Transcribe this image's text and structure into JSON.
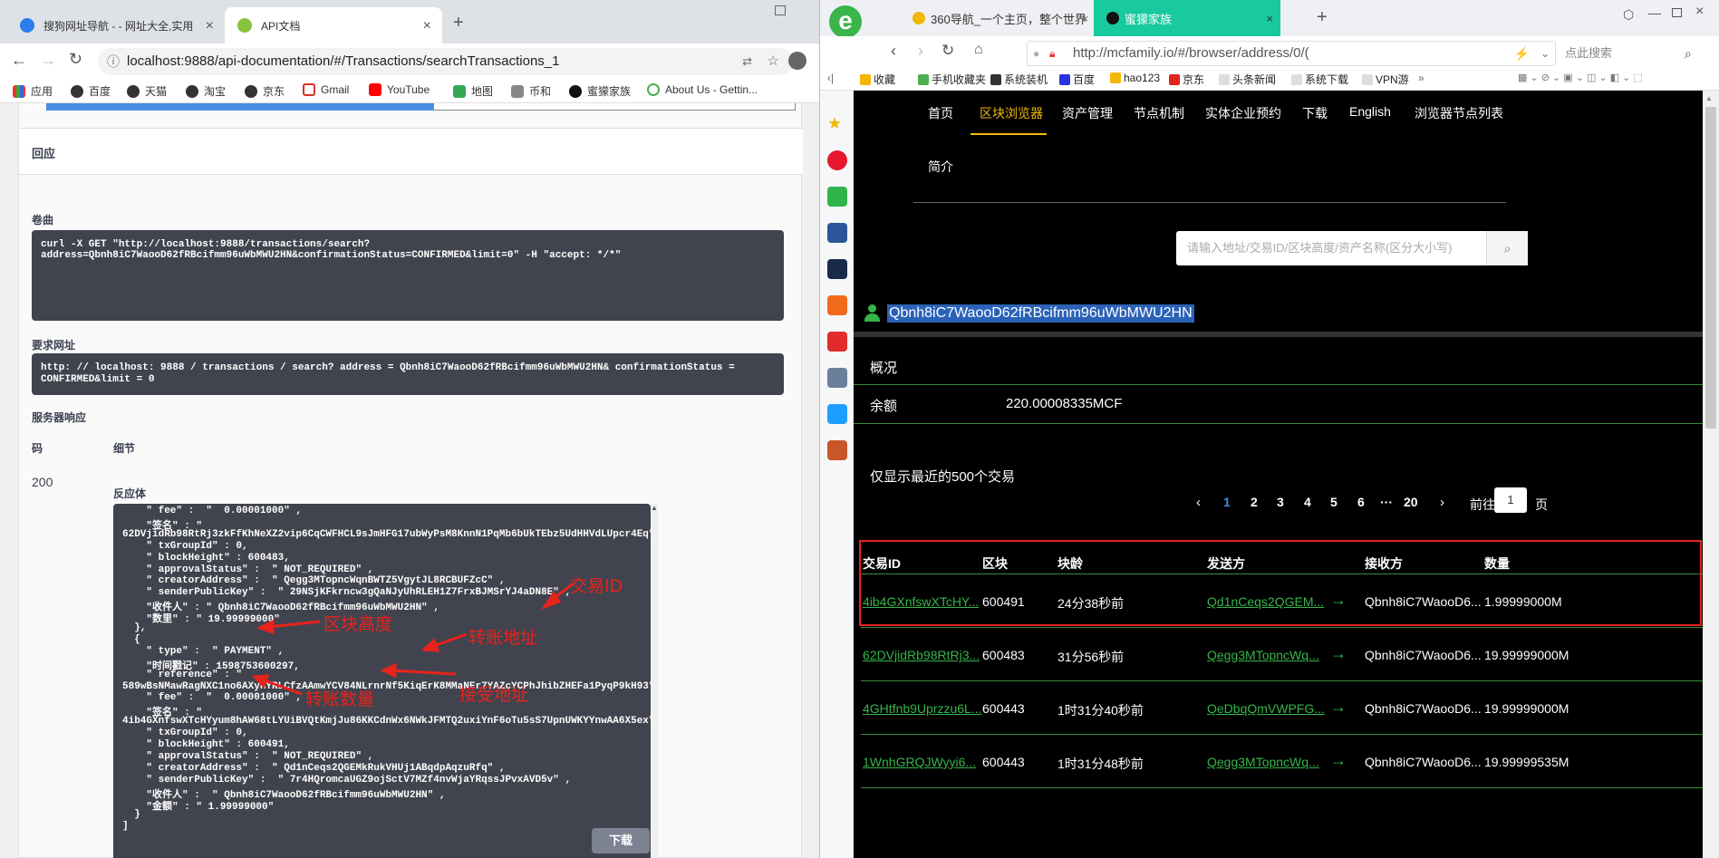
{
  "left_browser": {
    "tabs": [
      {
        "title": "搜狗网址导航 - - 网址大全,实用"
      },
      {
        "title": "API文档"
      }
    ],
    "new_tab": "+",
    "url": "localhost:9888/api-documentation/#/Transactions/searchTransactions_1",
    "bookmarks": [
      "应用",
      "百度",
      "天猫",
      "淘宝",
      "京东",
      "Gmail",
      "YouTube",
      "地图",
      "币和",
      "蜜獴家族",
      "About Us - Gettin..."
    ]
  },
  "swagger": {
    "section_title": "回应",
    "curl_label": "卷曲",
    "curl_text_1": "curl -X GET \"http://localhost:9888/transactions/search?",
    "curl_text_2": "address=Qbnh8iC7WaooD62fRBcifmm96uWbMWU2HN&confirmationStatus=CONFIRMED&limit=0\" -H \"accept: */*\"",
    "request_url_label": "要求网址",
    "request_url_1": "http: // localhost: 9888 / transactions / search? address = Qbnh8iC7WaooD62fRBcifmm96uWbMWU2HN& confirmationStatus =",
    "request_url_2": "CONFIRMED&limit = 0",
    "server_response_label": "服务器响应",
    "col_code": "码",
    "col_detail": "细节",
    "status_code": "200",
    "response_body_label": "反应体",
    "download_button": "下载",
    "response_lines": [
      "    \" fee\" :  \"  0.00001000\" ,",
      "    \"签名\" : \"",
      "62DVjidRb98RtRj3zkFfKhNeXZ2vip6CqCWFHCL9sJmHFG17ubWyPsM8KnnN1PqMb6bUkTEbz5UdHHVdLUpcr4Eq\" ,",
      "    \" txGroupId\" : 0,",
      "    \" blockHeight\" : 600483,",
      "    \" approvalStatus\" :  \" NOT_REQUIRED\" ,",
      "    \" creatorAddress\" :  \" Qegg3MTopncWqnBWTZ5VgytJL8RCBUFZcC\" ,",
      "    \" senderPublicKey\" :  \" 29NSjKFkrncw3gQaNJyUhRLEH1Z7FrxBJMSrYJ4aDN8E\" ,",
      "    \"收件人\" : \" Qbnh8iC7WaooD62fRBcifmm96uWbMWU2HN\" ,",
      "    \"数里\" : \" 19.99999000\"",
      "  },",
      "  {",
      "    \" type\" :  \" PAYMENT\" ,",
      "    \"时间戳记\" : 1598753600297,",
      "    \" reference\" : \"",
      "589wBsNMawRagNXC1no6AXyHYRLCfzAAmwYCV84NLrnrNf5KiqErK8MMaNEr7YAZcYCPhJhibZHEFa1PyqP9kH93\"",
      "    \" fee\" :  \"  0.00001000\" ,",
      "    \"签名\" : \"",
      "4ib4GXnfswXTcHYyum8hAW68tLYUiBVQtKmjJu86KKCdnWx6NWkJFMTQ2uxiYnF6oTu5sS7UpnUWKYYnwAA6X5ex\" ,",
      "    \" txGroupId\" : 0,",
      "    \" blockHeight\" : 600491,",
      "    \" approvalStatus\" :  \" NOT_REQUIRED\" ,",
      "    \" creatorAddress\" :  \" Qd1nCeqs2QGEMkRukVHUj1ABqdpAqzuRfq\" ,",
      "    \" senderPublicKey\" :  \" 7r4HQromcaUGZ9ojSctV7MZf4nvWjaYRqssJPvxAVD5v\" ,",
      "    \"收件人\" :  \" Qbnh8iC7WaooD62fRBcifmm96uWbMWU2HN\" ,",
      "    \"金额\" : \" 1.99999000\"",
      "  }",
      "]"
    ],
    "annotations": {
      "tx_id": "交易ID",
      "block_height": "区块高度",
      "transfer_address": "转账地址",
      "receive_address": "接受地址",
      "transfer_amount": "转账数量"
    }
  },
  "right_browser": {
    "tabs": [
      {
        "title": "360导航_一个主页，整个世界"
      },
      {
        "title": "蜜獴家族"
      }
    ],
    "url": "http://mcfamily.io/#/browser/address/0/(",
    "search_placeholder": "点此搜索",
    "favorites": [
      "收藏",
      "手机收藏夹",
      "系统装机",
      "百度",
      "hao123",
      "京东",
      "头条新闻",
      "系统下载",
      "VPN游"
    ],
    "more": "»"
  },
  "site": {
    "nav": [
      "首页",
      "区块浏览器",
      "资产管理",
      "节点机制",
      "实体企业预约",
      "下载",
      "English",
      "浏览器节点列表"
    ],
    "nav_second": "简介",
    "search_placeholder": "请输入地址/交易ID/区块高度/资产名称(区分大小写)",
    "address": "Qbnh8iC7WaooD62fRBcifmm96uWbMWU2HN",
    "overview_label": "概况",
    "balance_label": "余额",
    "balance_value": "220.00008335MCF",
    "recent_label": "仅显示最近的500个交易",
    "pagination": {
      "prev": "‹",
      "pages": [
        "1",
        "2",
        "3",
        "4",
        "5",
        "6",
        "···",
        "20"
      ],
      "next": "›",
      "goto_label": "前往",
      "goto_value": "1",
      "page_suffix": "页"
    },
    "table_headers": [
      "交易ID",
      "区块",
      "块龄",
      "发送方",
      "接收方",
      "数量"
    ],
    "rows": [
      {
        "id": "4ib4GXnfswXTcHY...",
        "block": "600491",
        "age": "24分38秒前",
        "sender": "Qd1nCeqs2QGEM...",
        "arrow": "→",
        "receiver": "Qbnh8iC7WaooD6...",
        "amount": "1.99999000M"
      },
      {
        "id": "62DVjidRb98RtRj3...",
        "block": "600483",
        "age": "31分56秒前",
        "sender": "Qegg3MTopncWq...",
        "arrow": "→",
        "receiver": "Qbnh8iC7WaooD6...",
        "amount": "19.99999000M"
      },
      {
        "id": "4GHtfnb9Uprzzu6L...",
        "block": "600443",
        "age": "1时31分40秒前",
        "sender": "QeDbqQmVWPFG...",
        "arrow": "→",
        "receiver": "Qbnh8iC7WaooD6...",
        "amount": "19.99999000M"
      },
      {
        "id": "1WnhGRQJWyyi6...",
        "block": "600443",
        "age": "1时31分48秒前",
        "sender": "Qegg3MTopncWq...",
        "arrow": "→",
        "receiver": "Qbnh8iC7WaooD6...",
        "amount": "19.99999535M"
      }
    ]
  },
  "colors": {
    "accent_green": "#35b54a",
    "nav_active": "#f0b90b",
    "annotation_red": "#e8221c",
    "code_bg": "#41444e"
  }
}
